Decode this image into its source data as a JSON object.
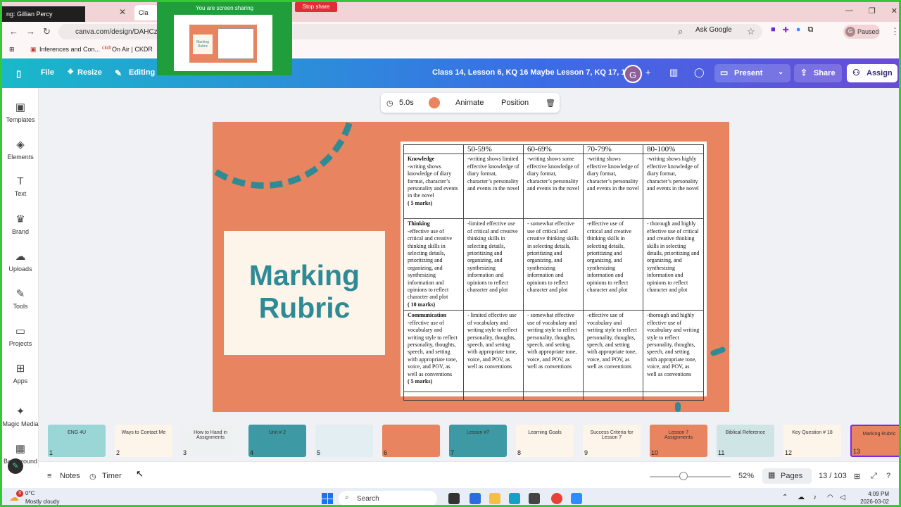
{
  "browser": {
    "tab_sharing": "ng: Gillian Percy",
    "tab_canva": "Cla",
    "url": "canva.com/design/DAHCznc",
    "ask_google": "Ask Google",
    "profile_status": "Paused",
    "profile_initial": "G",
    "bookmarks": [
      "Inferences and Con...",
      "On Air | CKDR"
    ]
  },
  "screen_share": {
    "banner": "You are screen sharing",
    "stop_label": "Stop share",
    "thumb_title": "Marking Rubric"
  },
  "header": {
    "file": "File",
    "resize": "Resize",
    "editing": "Editing",
    "doc_title": "Class 14, Lesson 6, KQ 16 Maybe Lesson 7, KQ 17, 18",
    "avatar": "G",
    "present": "Present",
    "share": "Share",
    "assign": "Assign"
  },
  "sidebar": [
    {
      "label": "Templates",
      "icon": "templates-icon",
      "glyph": "▣"
    },
    {
      "label": "Elements",
      "icon": "elements-icon",
      "glyph": "◈"
    },
    {
      "label": "Text",
      "icon": "text-icon",
      "glyph": "T"
    },
    {
      "label": "Brand",
      "icon": "brand-icon",
      "glyph": "♛"
    },
    {
      "label": "Uploads",
      "icon": "uploads-icon",
      "glyph": "☁"
    },
    {
      "label": "Tools",
      "icon": "tools-icon",
      "glyph": "✎"
    },
    {
      "label": "Projects",
      "icon": "projects-icon",
      "glyph": "▭"
    },
    {
      "label": "Apps",
      "icon": "apps-icon",
      "glyph": "⊞"
    },
    {
      "label": "Magic Media",
      "icon": "magic-media-icon",
      "glyph": "✦"
    },
    {
      "label": "Background",
      "icon": "background-icon",
      "glyph": "▦"
    }
  ],
  "element_toolbar": {
    "duration": "5.0s",
    "animate": "Animate",
    "position": "Position",
    "color": "#e8845f"
  },
  "slide": {
    "title": "Marking\nRubric",
    "bg_color": "#e8845f",
    "accent_color": "#2e8b96",
    "rubric": {
      "headers": [
        "",
        "50-59%",
        "60-69%",
        "70-79%",
        "80-100%"
      ],
      "rows": [
        {
          "criterion": "Knowledge",
          "description": "-writing shows knowledge of diary format, character’s personality and events in the novel",
          "marks": "( 5 marks)",
          "levels": [
            "-writing shows limited effective knowledge of diary format, character’s personality and events in the novel",
            "-writing shows some effective knowledge of diary format, character’s personality and events in the novel",
            "-writing shows effective knowledge of diary format, character’s personality and events in the novel",
            "-writing shows highly effective knowledge of diary format, character’s personality and events in the novel"
          ]
        },
        {
          "criterion": "Thinking",
          "description": "-effective use of critical and creative thinking skills in selecting details, prioritizing and organizing, and synthesizing information and opinions to reflect character and plot",
          "marks": "( 10 marks)",
          "levels": [
            "-limited effective use of critical and creative thinking skills in selecting details, prioritizing and organizing, and synthesizing information and opinions to reflect character and plot",
            "- somewhat effective use of critical and creative thinking skills in selecting details, prioritizing and organizing, and synthesizing information and opinions to reflect character and plot",
            "-effective use of critical and creative thinking skills in selecting details, prioritizing and organizing, and synthesizing information and opinions to reflect character and plot",
            "- thorough and highly effective use of critical and creative thinking skills in selecting details, prioritizing and organizing, and synthesizing information and opinions to reflect character and plot"
          ]
        },
        {
          "criterion": "Communication",
          "description": "-effective use of vocabulary and writing style to reflect personality, thoughts, speech, and setting with appropriate tone, voice, and POV, as well as conventions",
          "marks": "( 5 marks)",
          "levels": [
            "- limited effective use of vocabulary and writing style to reflect personality, thoughts, speech, and setting with appropriate tone, voice, and POV, as well as conventions",
            "- somewhat effective use of vocabulary and writing style to reflect personality, thoughts, speech, and setting with appropriate tone, voice, and POV, as well as conventions",
            "-effective use of vocabulary and writing style to reflect personality, thoughts, speech, and setting with appropriate tone, voice, and POV, as well as conventions",
            "-thorough and highly effective use of vocabulary and writing style to reflect personality, thoughts, speech, and setting with appropriate tone, voice, and POV, as well as conventions"
          ]
        }
      ]
    }
  },
  "filmstrip": [
    {
      "num": "1",
      "title": "ENG 4U",
      "bg": "#9ad6d6"
    },
    {
      "num": "2",
      "title": "Ways to Contact Me",
      "bg": "#fdf4ea"
    },
    {
      "num": "3",
      "title": "How to Hand in Assignments",
      "bg": "#eef1f1"
    },
    {
      "num": "4",
      "title": "Unit # 2",
      "bg": "#3d9aa5"
    },
    {
      "num": "5",
      "title": "",
      "bg": "#e3eef2"
    },
    {
      "num": "6",
      "title": "",
      "bg": "#e8845f"
    },
    {
      "num": "7",
      "title": "Lesson #7",
      "bg": "#3d9aa5"
    },
    {
      "num": "8",
      "title": "Learning Goals",
      "bg": "#fdf4ea"
    },
    {
      "num": "9",
      "title": "Success Criteria for Lesson 7",
      "bg": "#fdf4ea"
    },
    {
      "num": "10",
      "title": "Lesson 7 Assignments",
      "bg": "#e8845f"
    },
    {
      "num": "11",
      "title": "Biblical Reference",
      "bg": "#cfe4e4"
    },
    {
      "num": "12",
      "title": "Key Question # 18",
      "bg": "#fdf4ea"
    },
    {
      "num": "13",
      "title": "Marking Rubric",
      "bg": "#e8845f"
    }
  ],
  "bottom_bar": {
    "notes": "Notes",
    "timer": "Timer",
    "zoom": "52%",
    "pages": "Pages",
    "page_count": "13 / 103"
  },
  "taskbar": {
    "temp": "0°C",
    "weather": "Mostly cloudy",
    "search": "Search",
    "time": "4:09 PM",
    "date": "2026-03-02",
    "weather_badge": "3"
  }
}
